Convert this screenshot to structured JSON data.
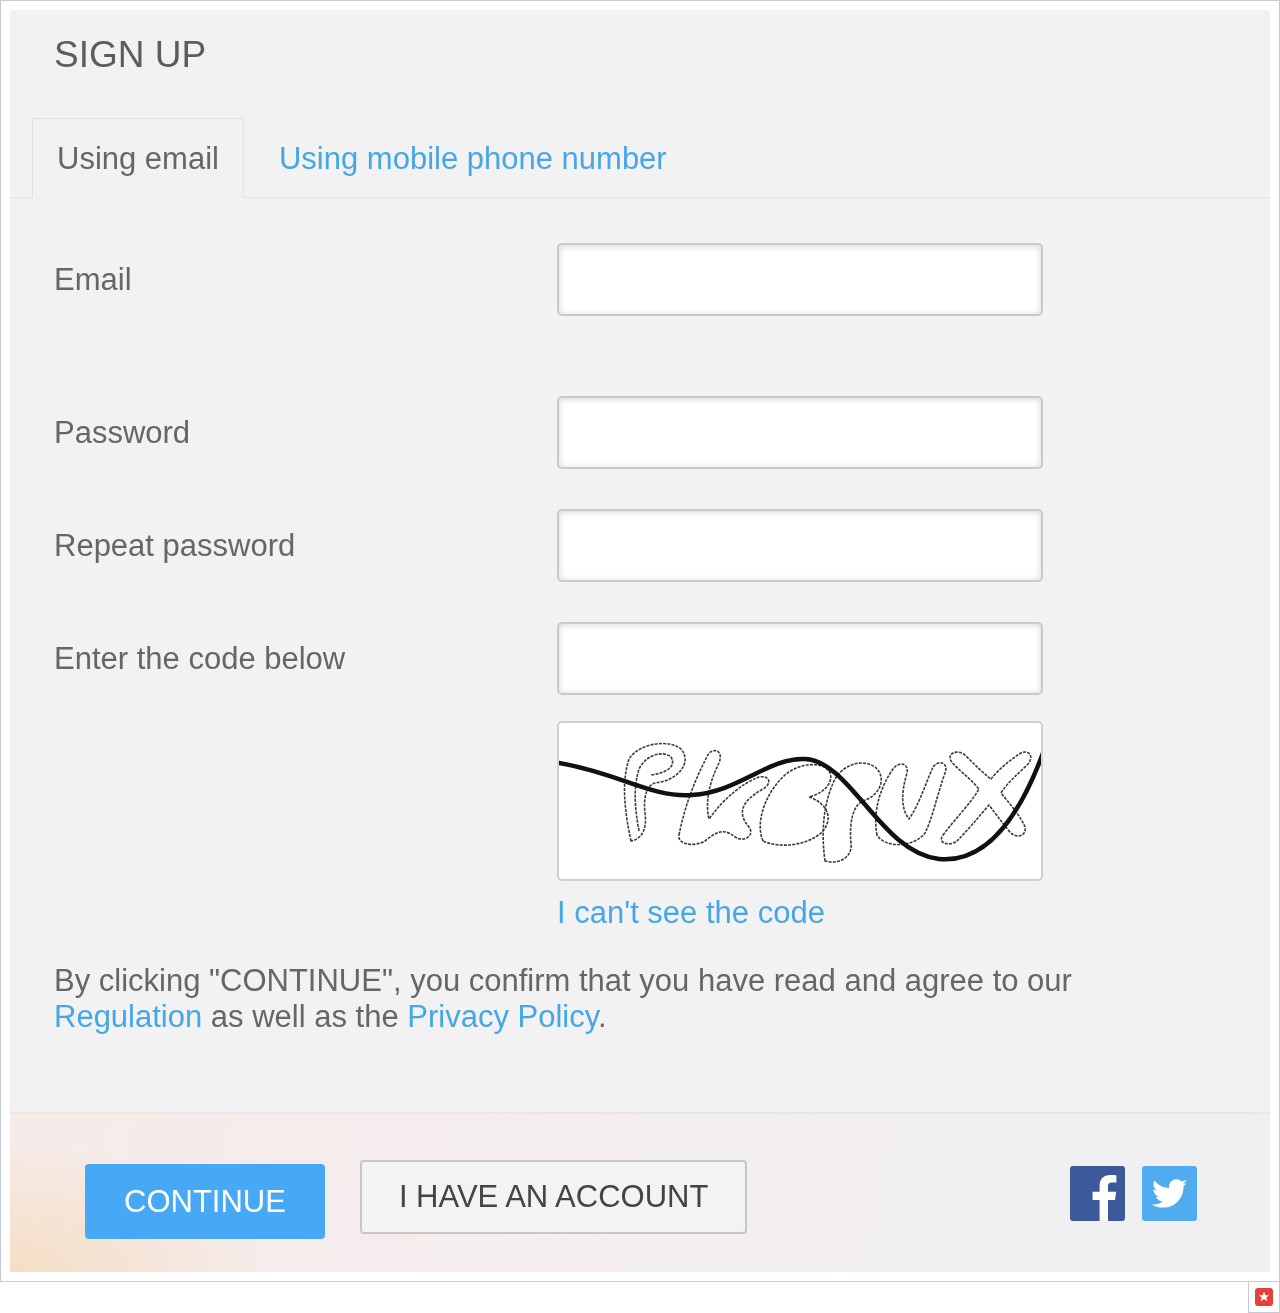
{
  "title": "SIGN UP",
  "tabs": [
    {
      "label": "Using email",
      "selected": true
    },
    {
      "label": "Using mobile phone number",
      "selected": false
    }
  ],
  "fields": [
    {
      "label": "Email"
    },
    {
      "label": "Password"
    },
    {
      "label": "Repeat password"
    },
    {
      "label": "Enter the code below"
    }
  ],
  "captcha": {
    "help_link": "I can't see the code"
  },
  "consent": [
    {
      "kind": "text",
      "text": "By clicking \"CONTINUE\", you confirm that you have read and agree to our "
    },
    {
      "kind": "link",
      "text": "Regulation"
    },
    {
      "kind": "text",
      "text": " as well as the "
    },
    {
      "kind": "link",
      "text": "Privacy Policy"
    },
    {
      "kind": "text",
      "text": "."
    }
  ],
  "buttons": [
    {
      "label": "CONTINUE",
      "kind": "primary"
    },
    {
      "label": "I HAVE AN ACCOUNT",
      "kind": "secondary"
    }
  ]
}
